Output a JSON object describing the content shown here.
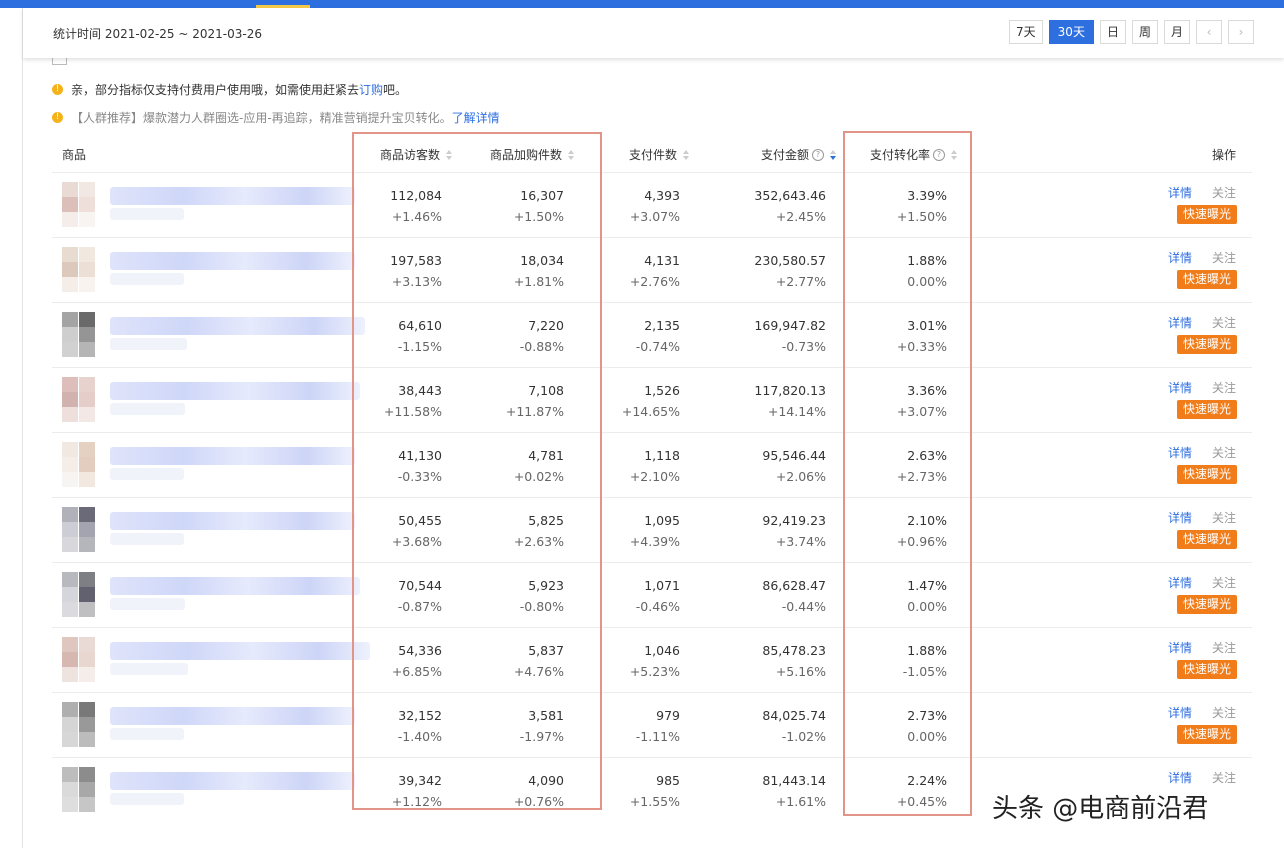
{
  "header": {
    "stat_time": "统计时间 2021-02-25 ~ 2021-03-26",
    "ranges": [
      "7天",
      "30天",
      "日",
      "周",
      "月"
    ],
    "active_range": "30天",
    "prev_symbol": "‹",
    "next_symbol": "›"
  },
  "notices": [
    {
      "text": "亲，部分指标仅支持付费用户使用哦，如需使用赶紧去",
      "link": "订购",
      "tail": "吧。"
    },
    {
      "text": "【人群推荐】爆款潜力人群圈选-应用-再追踪，精准营销提升宝贝转化。",
      "link": "了解详情",
      "tail": ""
    }
  ],
  "table": {
    "columns": {
      "product": "商品",
      "visitors": "商品访客数",
      "cart": "商品加购件数",
      "paid_qty": "支付件数",
      "paid_amount": "支付金额",
      "conversion": "支付转化率",
      "action": "操作"
    },
    "rows": [
      {
        "visitors": "112,084",
        "visitors_chg": "+1.46%",
        "cart": "16,307",
        "cart_chg": "+1.50%",
        "qty": "4,393",
        "qty_chg": "+3.07%",
        "amount": "352,643.46",
        "amount_chg": "+2.45%",
        "rate": "3.39%",
        "rate_chg": "+1.50%"
      },
      {
        "visitors": "197,583",
        "visitors_chg": "+3.13%",
        "cart": "18,034",
        "cart_chg": "+1.81%",
        "qty": "4,131",
        "qty_chg": "+2.76%",
        "amount": "230,580.57",
        "amount_chg": "+2.77%",
        "rate": "1.88%",
        "rate_chg": "0.00%"
      },
      {
        "visitors": "64,610",
        "visitors_chg": "-1.15%",
        "cart": "7,220",
        "cart_chg": "-0.88%",
        "qty": "2,135",
        "qty_chg": "-0.74%",
        "amount": "169,947.82",
        "amount_chg": "-0.73%",
        "rate": "3.01%",
        "rate_chg": "+0.33%"
      },
      {
        "visitors": "38,443",
        "visitors_chg": "+11.58%",
        "cart": "7,108",
        "cart_chg": "+11.87%",
        "qty": "1,526",
        "qty_chg": "+14.65%",
        "amount": "117,820.13",
        "amount_chg": "+14.14%",
        "rate": "3.36%",
        "rate_chg": "+3.07%"
      },
      {
        "visitors": "41,130",
        "visitors_chg": "-0.33%",
        "cart": "4,781",
        "cart_chg": "+0.02%",
        "qty": "1,118",
        "qty_chg": "+2.10%",
        "amount": "95,546.44",
        "amount_chg": "+2.06%",
        "rate": "2.63%",
        "rate_chg": "+2.73%"
      },
      {
        "visitors": "50,455",
        "visitors_chg": "+3.68%",
        "cart": "5,825",
        "cart_chg": "+2.63%",
        "qty": "1,095",
        "qty_chg": "+4.39%",
        "amount": "92,419.23",
        "amount_chg": "+3.74%",
        "rate": "2.10%",
        "rate_chg": "+0.96%"
      },
      {
        "visitors": "70,544",
        "visitors_chg": "-0.87%",
        "cart": "5,923",
        "cart_chg": "-0.80%",
        "qty": "1,071",
        "qty_chg": "-0.46%",
        "amount": "86,628.47",
        "amount_chg": "-0.44%",
        "rate": "1.47%",
        "rate_chg": "0.00%"
      },
      {
        "visitors": "54,336",
        "visitors_chg": "+6.85%",
        "cart": "5,837",
        "cart_chg": "+4.76%",
        "qty": "1,046",
        "qty_chg": "+5.23%",
        "amount": "85,478.23",
        "amount_chg": "+5.16%",
        "rate": "1.88%",
        "rate_chg": "-1.05%"
      },
      {
        "visitors": "32,152",
        "visitors_chg": "-1.40%",
        "cart": "3,581",
        "cart_chg": "-1.97%",
        "qty": "979",
        "qty_chg": "-1.11%",
        "amount": "84,025.74",
        "amount_chg": "-1.02%",
        "rate": "2.73%",
        "rate_chg": "0.00%"
      },
      {
        "visitors": "39,342",
        "visitors_chg": "+1.12%",
        "cart": "4,090",
        "cart_chg": "+0.76%",
        "qty": "985",
        "qty_chg": "+1.55%",
        "amount": "81,443.14",
        "amount_chg": "+1.61%",
        "rate": "2.24%",
        "rate_chg": "+0.45%"
      }
    ],
    "row_actions": {
      "detail": "详情",
      "follow": "关注",
      "expose": "快速曝光"
    }
  },
  "watermark": "头条 @电商前沿君",
  "colors": {
    "accent": "#2e6fe0",
    "expose_button": "#f07c1a",
    "highlight_box": "#e29489",
    "notice_icon": "#f5b31b"
  }
}
